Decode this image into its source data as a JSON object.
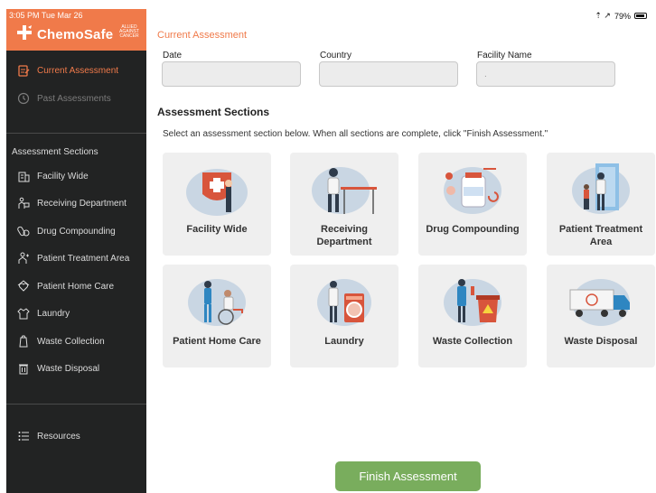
{
  "status_bar": {
    "time": "3:05 PM  Tue Mar 26",
    "signal": "⇡ ↗",
    "battery": "79%"
  },
  "brand": {
    "name": "ChemoSafe",
    "tagline": "ALLIED AGAINST CANCER"
  },
  "sidebar": {
    "top_items": [
      {
        "label": "Current Assessment",
        "icon": "clipboard-icon"
      },
      {
        "label": "Past Assessments",
        "icon": "history-icon"
      }
    ],
    "sections_heading": "Assessment Sections",
    "section_items": [
      {
        "label": "Facility Wide",
        "icon": "building-icon"
      },
      {
        "label": "Receiving Department",
        "icon": "receiving-icon"
      },
      {
        "label": "Drug Compounding",
        "icon": "compounding-icon"
      },
      {
        "label": "Patient Treatment Area",
        "icon": "treatment-icon"
      },
      {
        "label": "Patient Home Care",
        "icon": "home-care-icon"
      },
      {
        "label": "Laundry",
        "icon": "laundry-icon"
      },
      {
        "label": "Waste Collection",
        "icon": "waste-collection-icon"
      },
      {
        "label": "Waste Disposal",
        "icon": "trash-icon"
      }
    ],
    "resources": {
      "label": "Resources",
      "icon": "list-icon"
    }
  },
  "main": {
    "title": "Current Assessment",
    "fields": [
      {
        "label": "Date",
        "value": ""
      },
      {
        "label": "Country",
        "value": ""
      },
      {
        "label": "Facility Name",
        "value": "."
      }
    ],
    "sections_title": "Assessment Sections",
    "instructions": "Select an assessment section below. When all sections are complete, click \"Finish Assessment.\"",
    "cards": [
      {
        "label": "Facility Wide"
      },
      {
        "label": "Receiving Department"
      },
      {
        "label": "Drug Compounding"
      },
      {
        "label": "Patient Treatment Area"
      },
      {
        "label": "Patient Home Care"
      },
      {
        "label": "Laundry"
      },
      {
        "label": "Waste Collection"
      },
      {
        "label": "Waste Disposal"
      }
    ],
    "finish_button": "Finish Assessment"
  },
  "colors": {
    "accent": "#f07a4a",
    "sidebar_bg": "#222323",
    "finish_button": "#79ad5d",
    "card_bg": "#efefef"
  }
}
